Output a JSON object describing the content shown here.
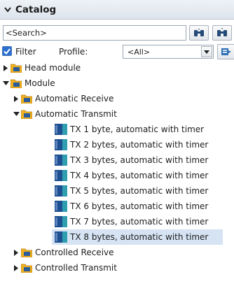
{
  "panel": {
    "title": "Catalog"
  },
  "search": {
    "value": "<Search>"
  },
  "filter": {
    "label": "Filter",
    "checked": true,
    "profile_label": "Profile:",
    "profile_value": "<All>"
  },
  "tree": {
    "head_module": "Head module",
    "module": "Module",
    "automatic_receive": "Automatic Receive",
    "automatic_transmit": "Automatic Transmit",
    "tx_items": [
      "TX 1 byte, automatic with timer",
      "TX 2 bytes, automatic with timer",
      "TX 3 bytes, automatic with timer",
      "TX 4 bytes, automatic with timer",
      "TX 5 bytes, automatic with timer",
      "TX 6 bytes, automatic with timer",
      "TX 7 bytes, automatic with timer",
      "TX 8 bytes, automatic with timer"
    ],
    "controlled_receive": "Controlled Receive",
    "controlled_transmit": "Controlled Transmit"
  },
  "colors": {
    "accent": "#2b6fd0",
    "selection": "#d5e3f3",
    "folder": "#f0b020",
    "module_icon": "#1d4f91"
  }
}
